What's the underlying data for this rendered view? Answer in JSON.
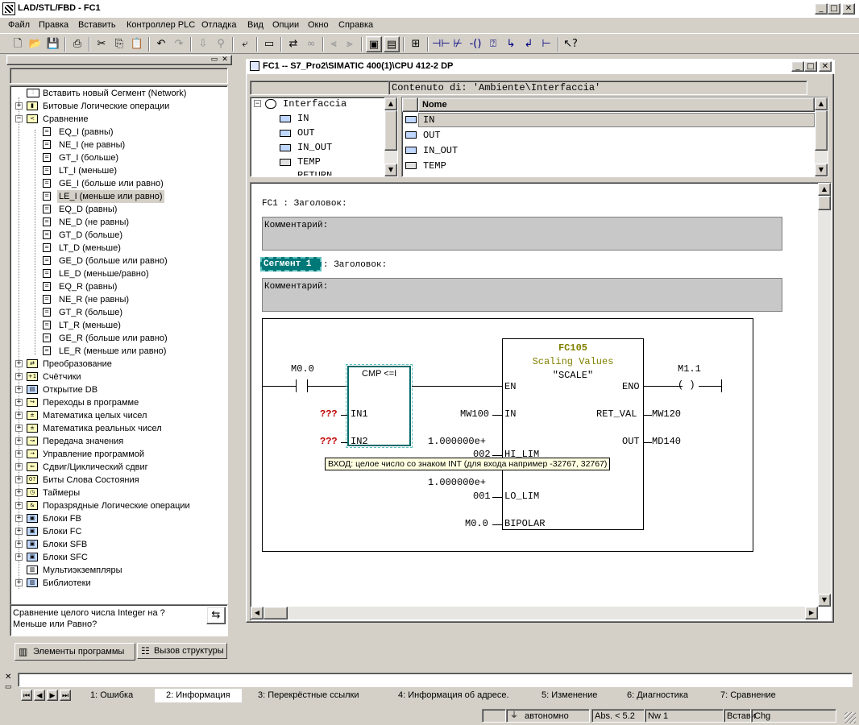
{
  "app": {
    "title": "LAD/STL/FBD - FC1"
  },
  "menu": [
    "Файл",
    "Правка",
    "Вставить",
    "Контроллер PLC",
    "Отладка",
    "Вид",
    "Опции",
    "Окно",
    "Справка"
  ],
  "tree": {
    "items": [
      {
        "label": "Вставить новый Сегмент (Network)"
      },
      {
        "label": "Битовые Логические операции"
      },
      {
        "label": "Сравнение"
      },
      {
        "label": "EQ_I (равны)"
      },
      {
        "label": "NE_I (не равны)"
      },
      {
        "label": "GT_I (больше)"
      },
      {
        "label": "LT_I (меньше)"
      },
      {
        "label": "GE_I (больше или равно)"
      },
      {
        "label": "LE_I (меньше или равно)"
      },
      {
        "label": "EQ_D (равны)"
      },
      {
        "label": "NE_D (не равны)"
      },
      {
        "label": "GT_D (больше)"
      },
      {
        "label": "LT_D (меньше)"
      },
      {
        "label": "GE_D (больше или равно)"
      },
      {
        "label": "LE_D (меньше/равно)"
      },
      {
        "label": "EQ_R (равны)"
      },
      {
        "label": "NE_R (не равны)"
      },
      {
        "label": "GT_R (больше)"
      },
      {
        "label": "LT_R (меньше)"
      },
      {
        "label": "GE_R (больше или равно)"
      },
      {
        "label": "LE_R (меньше или равно)"
      },
      {
        "label": "Преобразование"
      },
      {
        "label": "Счётчики"
      },
      {
        "label": "Открытие DB"
      },
      {
        "label": "Переходы в программе"
      },
      {
        "label": "Математика целых чисел"
      },
      {
        "label": "Математика реальных чисел"
      },
      {
        "label": "Передача значения"
      },
      {
        "label": "Управление программой"
      },
      {
        "label": "Сдвиг/Циклический сдвиг"
      },
      {
        "label": "Биты Слова Состояния"
      },
      {
        "label": "Таймеры"
      },
      {
        "label": "Поразрядные Логические операции"
      },
      {
        "label": "Блоки FB"
      },
      {
        "label": "Блоки FC"
      },
      {
        "label": "Блоки SFB"
      },
      {
        "label": "Блоки SFC"
      },
      {
        "label": "Мультиэкземпляры"
      },
      {
        "label": "Библиотеки"
      }
    ],
    "info": "Сравнение целого числа Integer на ?Меньше или Равно?",
    "tab_elements": "Элементы программы",
    "tab_calls": "Вызов структуры"
  },
  "editor": {
    "title": "FC1 -- S7_Pro2\\SIMATIC 400(1)\\CPU 412-2 DP",
    "content_label": "Contenuto di: 'Ambiente\\Interfaccia'",
    "interface_tree": [
      "Interfaccia",
      "IN",
      "OUT",
      "IN_OUT",
      "TEMP",
      "RETURN"
    ],
    "col_name": "Nome",
    "names": [
      "IN",
      "OUT",
      "IN_OUT",
      "TEMP"
    ],
    "fc_title": "FC1 : Заголовок:",
    "comment1": "Комментарий:",
    "segment": "Сегмент 1",
    "segment_title": ": Заголовок:",
    "comment2": "Комментарий:",
    "ladder": {
      "contact1": "M0.0",
      "cmp_label": "CMP <=I",
      "in1_val": "???",
      "in1": "IN1",
      "in2_val": "???",
      "in2": "IN2",
      "fc_name": "FC105",
      "fc_desc": "Scaling Values",
      "fc_sym": "\"SCALE\"",
      "en": "EN",
      "eno": "ENO",
      "coil": "M1.1",
      "coil_sym": "( )",
      "in_val": "MW100",
      "in": "IN",
      "retval": "RET_VAL",
      "retval_val": "MW120",
      "out": "OUT",
      "out_val": "MD140",
      "hilim_val": "1.000000e+",
      "hilim_suffix": "002",
      "hilim": "HI_LIM",
      "lolim_val": "1.000000e+",
      "lolim_suffix": "001",
      "lolim": "LO_LIM",
      "bipolar_val": "M0.0",
      "bipolar": "BIPOLAR",
      "tooltip": "ВХОД: целое число со знаком INT (для входа например -32767, 32767)"
    }
  },
  "tabs": [
    "1: Ошибка",
    "2: Информация",
    "3: Перекрёстные ссылки",
    "4: Информация об адресе.",
    "5: Изменение",
    "6: Диагностика",
    "7: Сравнение"
  ],
  "status": {
    "mode": "автономно",
    "abs": "Abs. < 5.2",
    "nw": "Nw 1",
    "ins": "Встави",
    "chg": "Chg"
  }
}
